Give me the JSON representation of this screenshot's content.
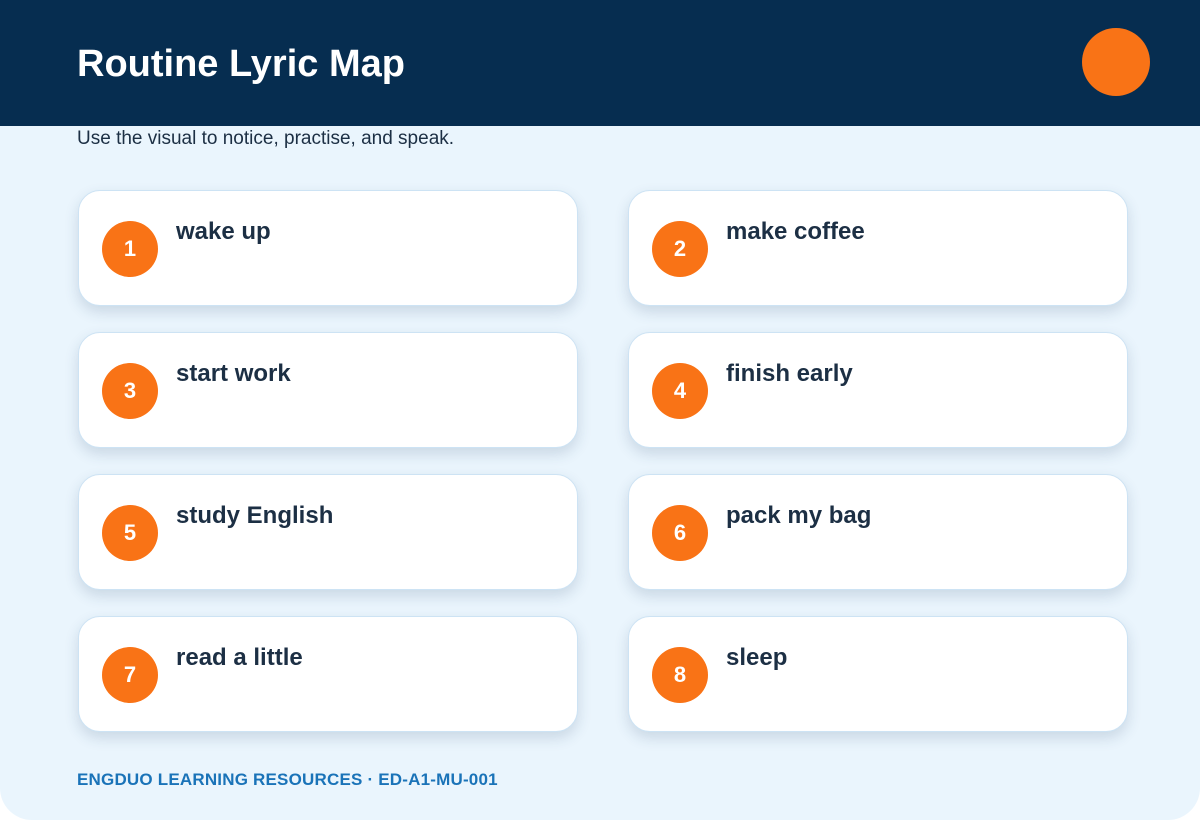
{
  "header": {
    "title": "Routine Lyric Map",
    "subtitle": "Use the visual to notice, practise, and speak."
  },
  "cards": [
    {
      "number": "1",
      "label": "wake up"
    },
    {
      "number": "2",
      "label": "make coffee"
    },
    {
      "number": "3",
      "label": "start work"
    },
    {
      "number": "4",
      "label": "finish early"
    },
    {
      "number": "5",
      "label": "study English"
    },
    {
      "number": "6",
      "label": "pack my bag"
    },
    {
      "number": "7",
      "label": "read a little"
    },
    {
      "number": "8",
      "label": "sleep"
    }
  ],
  "footer": {
    "text": "ENGDUO LEARNING RESOURCES · ED-A1-MU-001"
  },
  "colors": {
    "header_bg": "#062d50",
    "accent": "#f97316",
    "page_bg": "#eaf5fd",
    "footer_text": "#1a73b8"
  },
  "icons": {
    "accent_dot": "orange-circle-icon"
  }
}
